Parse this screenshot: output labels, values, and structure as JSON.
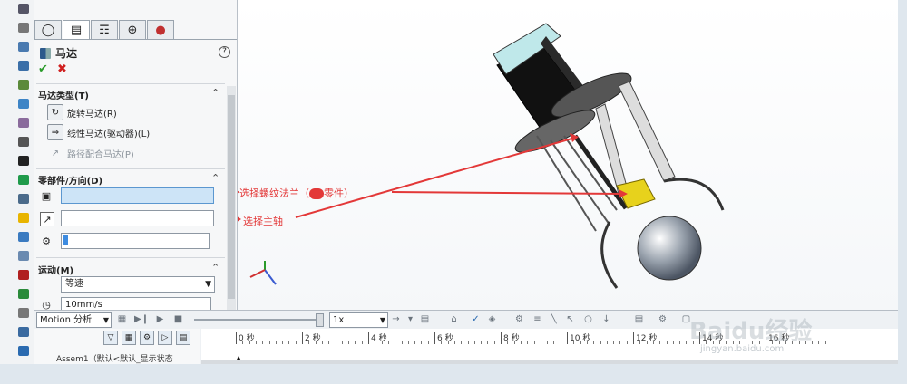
{
  "property_manager": {
    "title": "马达",
    "motor_type": {
      "header": "马达类型(T)",
      "options": [
        "旋转马达(R)",
        "线性马达(驱动器)(L)",
        "路径配合马达(P)"
      ]
    },
    "component_direction": {
      "header": "零部件/方向(D)"
    },
    "motion": {
      "header": "运动(M)",
      "type_value": "等速",
      "speed_value": "10mm/s"
    }
  },
  "timeline": {
    "study_type": "Motion 分析",
    "playback_speed": "1x",
    "ruler_labels": [
      "0 秒",
      "2 秒",
      "4 秒",
      "6 秒",
      "8 秒",
      "10 秒",
      "12 秒",
      "14 秒",
      "16 秒"
    ],
    "tree_row": "Assem1（默认<默认_显示状态"
  },
  "annotations": {
    "flange": "选择螺纹法兰（",
    "flange_tail": "零件）",
    "spindle": "选择主轴"
  },
  "watermark": {
    "logo": "Baidu经验",
    "url": "jingyan.baidu.com"
  },
  "colors": {
    "annotation_red": "#e33838",
    "active_field": "#cde4f7",
    "ok_green": "#2a9b2a",
    "cancel_red": "#d02020"
  }
}
